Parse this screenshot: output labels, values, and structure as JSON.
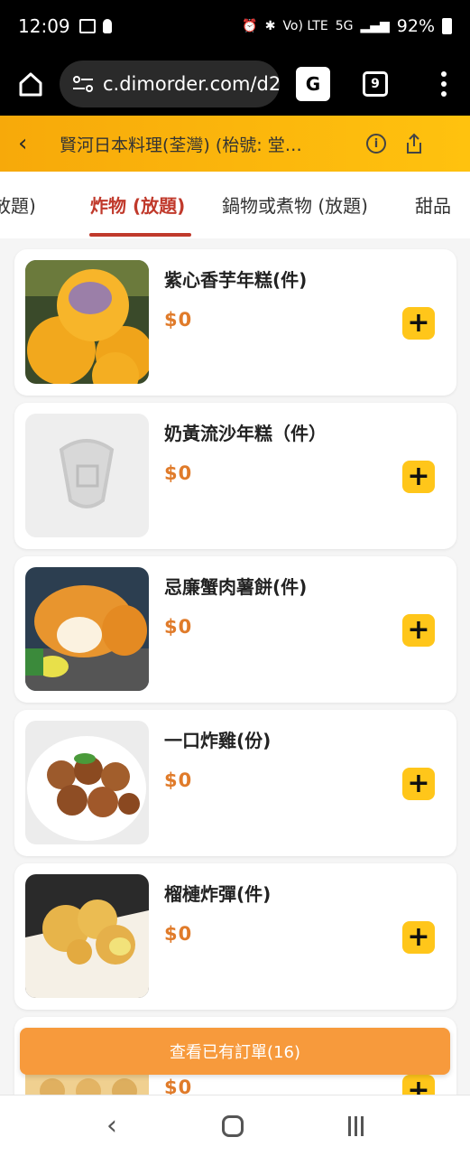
{
  "status": {
    "time": "12:09",
    "battery": "92%",
    "network": "Vo) LTE",
    "signal": "5G"
  },
  "browser": {
    "url": "c.dimorder.com/d2",
    "tab_count": "9",
    "translate_label": "G"
  },
  "header": {
    "title": "賢河日本料理(荃灣) (枱號: 堂…",
    "back": "‹",
    "info": "i"
  },
  "categories": [
    {
      "label": "放題)"
    },
    {
      "label": "炸物 (放題)",
      "active": true
    },
    {
      "label": "鍋物或煮物 (放題)"
    },
    {
      "label": "甜品"
    }
  ],
  "items": [
    {
      "name": "紫心香芋年糕(件)",
      "price": "$0",
      "image": "taro-rice-cake-photo"
    },
    {
      "name": "奶黃流沙年糕（件）",
      "price": "$0",
      "image": "placeholder-logo"
    },
    {
      "name": "忌廉蟹肉薯餅(件)",
      "price": "$0",
      "image": "crab-croquette-photo"
    },
    {
      "name": "一口炸雞(份)",
      "price": "$0",
      "image": "fried-chicken-photo"
    },
    {
      "name": "榴槤炸彈(件)",
      "price": "$0",
      "image": "durian-ball-photo"
    },
    {
      "name": "",
      "price": "$0",
      "image": "partial-item-photo"
    }
  ],
  "order_bar": {
    "label": "查看已有訂單(16)"
  },
  "colors": {
    "accent": "#ffc20e",
    "active_tab": "#c0392b",
    "price": "#e07b2a",
    "order_bar": "#f79a3c"
  }
}
